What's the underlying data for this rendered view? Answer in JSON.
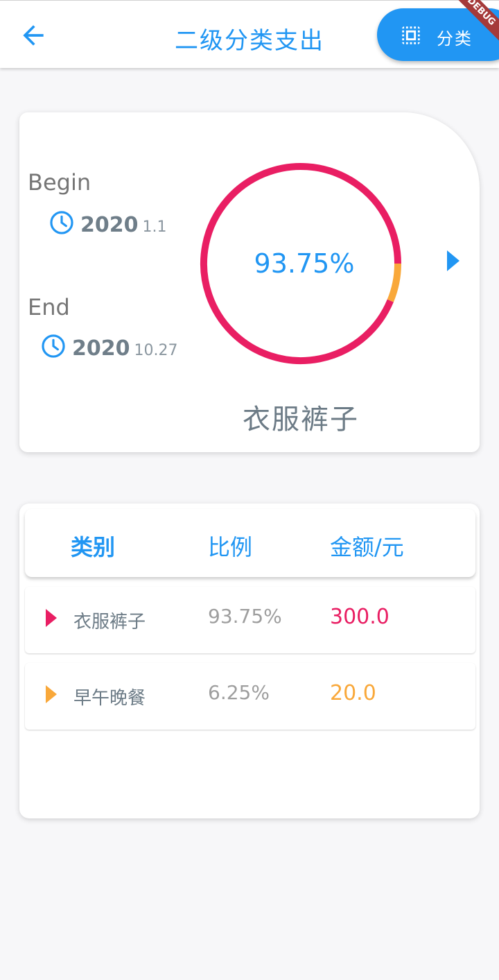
{
  "appbar": {
    "title": "二级分类支出",
    "category_button_label": "分类",
    "debug_banner": "DEBUG",
    "back_icon": "arrow-left-icon",
    "category_icon": "select-all-icon"
  },
  "summary": {
    "begin_label": "Begin",
    "begin_year": "2020",
    "begin_monthday": "1.1",
    "end_label": "End",
    "end_year": "2020",
    "end_monthday": "10.27",
    "percentage": "93.75%",
    "selected_name": "衣服裤子"
  },
  "table": {
    "headers": [
      "类别",
      "比例",
      "金额/元"
    ],
    "rows": [
      {
        "name": "衣服裤子",
        "percent": "93.75%",
        "amount": "300.0",
        "color": "#e91e63"
      },
      {
        "name": "早午晚餐",
        "percent": "6.25%",
        "amount": "20.0",
        "color": "#f9a83a"
      }
    ]
  },
  "colors": {
    "accent": "#2196f3",
    "segment_1": "#e91e63",
    "segment_2": "#f9a83a"
  },
  "chart_data": {
    "type": "pie",
    "categories": [
      "衣服裤子",
      "早午晚餐"
    ],
    "values": [
      300.0,
      20.0
    ],
    "percentages": [
      93.75,
      6.25
    ],
    "colors": [
      "#e91e63",
      "#f9a83a"
    ]
  }
}
